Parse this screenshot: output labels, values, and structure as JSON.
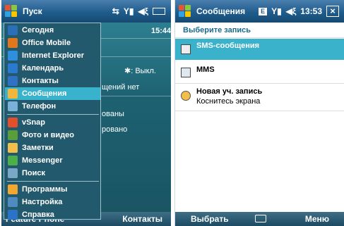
{
  "left": {
    "title": "Пуск",
    "time": "15:44",
    "bluetooth": ": Выкл.",
    "partials": [
      "щений нет",
      "ованы",
      "ровано"
    ],
    "menu": [
      {
        "label": "Сегодня",
        "icon": "today-icon",
        "color": "#2a6fb7",
        "group": 1
      },
      {
        "label": "Office Mobile",
        "icon": "office-icon",
        "color": "#e0771d",
        "group": 1
      },
      {
        "label": "Internet Explorer",
        "icon": "ie-icon",
        "color": "#2e8fe0",
        "group": 1
      },
      {
        "label": "Календарь",
        "icon": "calendar-icon",
        "color": "#2a7bd0",
        "group": 1
      },
      {
        "label": "Контакты",
        "icon": "contacts-icon",
        "color": "#2f72c4",
        "group": 1
      },
      {
        "label": "Сообщения",
        "icon": "messages-icon",
        "color": "#f2b63a",
        "group": 1,
        "selected": true
      },
      {
        "label": "Телефон",
        "icon": "phone-icon",
        "color": "#7bb0d8",
        "group": 1
      },
      {
        "label": "vSnap",
        "icon": "vsnap-icon",
        "color": "#e24f2a",
        "group": 2
      },
      {
        "label": "Фото и видео",
        "icon": "photo-icon",
        "color": "#5a9e3c",
        "group": 2
      },
      {
        "label": "Заметки",
        "icon": "notes-icon",
        "color": "#f2c04a",
        "group": 2
      },
      {
        "label": "Messenger",
        "icon": "messenger-icon",
        "color": "#4bb04a",
        "group": 2
      },
      {
        "label": "Поиск",
        "icon": "search-icon",
        "color": "#7aa7c7",
        "group": 2
      },
      {
        "label": "Программы",
        "icon": "programs-icon",
        "color": "#f0a830",
        "group": 3
      },
      {
        "label": "Настройка",
        "icon": "settings-icon",
        "color": "#4f8bc1",
        "group": 3
      },
      {
        "label": "Справка",
        "icon": "help-icon",
        "color": "#2b73c9",
        "group": 3
      }
    ],
    "softkeys": {
      "left_partial": "Feature Phone",
      "right": "Контакты"
    }
  },
  "right": {
    "title": "Сообщения",
    "time": "13:53",
    "header": "Выберите запись",
    "items": [
      {
        "label": "SMS-сообщения",
        "icon": "sms-icon",
        "selected": true
      },
      {
        "label": "MMS",
        "icon": "mms-icon"
      },
      {
        "label": "Новая уч. запись",
        "sub": "Коснитесь экрана",
        "icon": "new-account-icon"
      }
    ],
    "softkeys": {
      "left": "Выбрать",
      "right": "Меню"
    }
  },
  "colors": {
    "accent": "#3ab2cb",
    "titlebar": "#1f5c8c",
    "header_text": "#1c6a8c"
  }
}
